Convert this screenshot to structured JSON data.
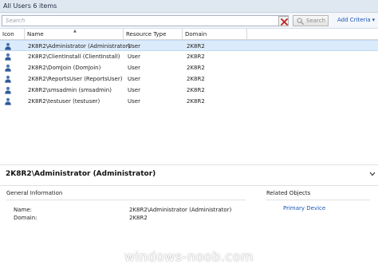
{
  "header": {
    "title": "All Users 6 items"
  },
  "search": {
    "placeholder": "Search",
    "button_label": "Search",
    "add_criteria_label": "Add Criteria"
  },
  "table": {
    "columns": [
      "Icon",
      "Name",
      "Resource Type",
      "Domain"
    ],
    "rows": [
      {
        "name": "2K8R2\\Administrator (Administrator)",
        "type": "User",
        "domain": "2K8R2"
      },
      {
        "name": "2K8R2\\ClientInstall (ClientInstall)",
        "type": "User",
        "domain": "2K8R2"
      },
      {
        "name": "2K8R2\\DomJoin (DomJoin)",
        "type": "User",
        "domain": "2K8R2"
      },
      {
        "name": "2K8R2\\ReportsUser (ReportsUser)",
        "type": "User",
        "domain": "2K8R2"
      },
      {
        "name": "2K8R2\\smsadmin (smsadmin)",
        "type": "User",
        "domain": "2K8R2"
      },
      {
        "name": "2K8R2\\testuser (testuser)",
        "type": "User",
        "domain": "2K8R2"
      }
    ],
    "selected_index": 0
  },
  "detail": {
    "title": "2K8R2\\Administrator (Administrator)",
    "general_heading": "General Information",
    "related_heading": "Related Objects",
    "name_label": "Name:",
    "name_value": "2K8R2\\Administrator (Administrator)",
    "domain_label": "Domain:",
    "domain_value": "2K8R2",
    "related_link": "Primary Device"
  },
  "watermark": "windows-noob.com",
  "icons": {
    "user": "user-icon",
    "clear": "clear-icon",
    "search": "search-icon",
    "collapse": "chevron-down-icon"
  },
  "colors": {
    "header_bg": "#dfe7f1",
    "selection": "#dcebfb",
    "link": "#1a55b8",
    "clear_x": "#c02020"
  }
}
